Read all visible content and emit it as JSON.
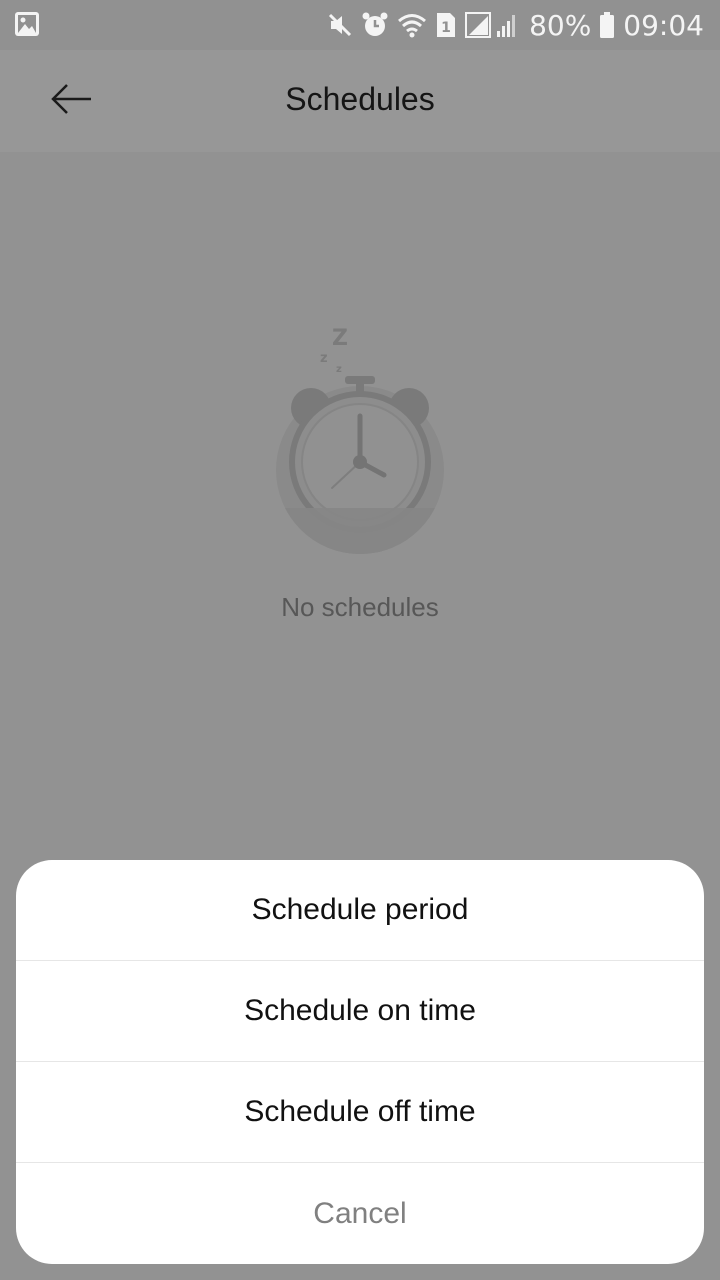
{
  "status_bar": {
    "battery_percent": "80%",
    "time": "09:04",
    "icons": [
      "image-icon",
      "mute-icon",
      "alarm-icon",
      "wifi-icon",
      "sim-icon",
      "signal-icon",
      "battery-icon"
    ]
  },
  "header": {
    "back_icon": "arrow-left-icon",
    "title": "Schedules"
  },
  "empty_state": {
    "illustration": "sleeping-alarm-clock",
    "message": "No schedules"
  },
  "action_sheet": {
    "items": [
      {
        "label": "Schedule period"
      },
      {
        "label": "Schedule on time"
      },
      {
        "label": "Schedule off time"
      },
      {
        "label": "Cancel"
      }
    ]
  }
}
